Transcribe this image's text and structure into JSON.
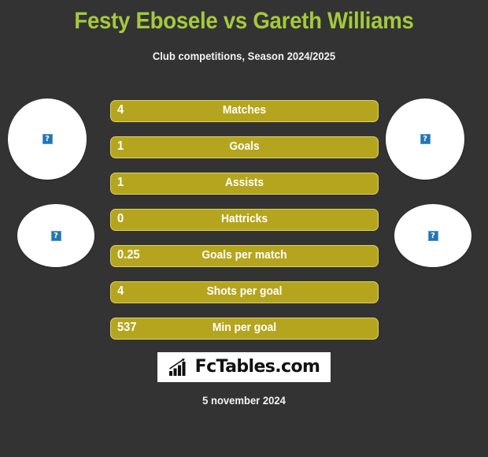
{
  "header": {
    "title": "Festy Ebosele vs Gareth Williams",
    "subtitle": "Club competitions, Season 2024/2025",
    "title_color": "#a5c93c",
    "background_color": "#333333"
  },
  "players": {
    "left": {
      "photo_alt": "broken-image",
      "placeholder_glyph": "?"
    },
    "right": {
      "photo_alt": "broken-image",
      "placeholder_glyph": "?"
    }
  },
  "chart_data": {
    "type": "bar",
    "title": "Festy Ebosele vs Gareth Williams",
    "subtitle": "Club competitions, Season 2024/2025",
    "categories": [
      "Matches",
      "Goals",
      "Assists",
      "Hattricks",
      "Goals per match",
      "Shots per goal",
      "Min per goal"
    ],
    "series": [
      {
        "name": "Festy Ebosele",
        "values": [
          4,
          1,
          1,
          0,
          0.25,
          4,
          537
        ],
        "labels": [
          "4",
          "1",
          "1",
          "0",
          "0.25",
          "4",
          "537"
        ]
      }
    ],
    "bar_fill_color": "#b5a51e",
    "bar_border_color": "#d8d35e",
    "label_color": "#ffffff",
    "grid": false,
    "legend": "none"
  },
  "rows": [
    {
      "value": "4",
      "label": "Matches"
    },
    {
      "value": "1",
      "label": "Goals"
    },
    {
      "value": "1",
      "label": "Assists"
    },
    {
      "value": "0",
      "label": "Hattricks"
    },
    {
      "value": "0.25",
      "label": "Goals per match"
    },
    {
      "value": "4",
      "label": "Shots per goal"
    },
    {
      "value": "537",
      "label": "Min per goal"
    }
  ],
  "footer": {
    "logo_text": "FcTables.com",
    "logo_icon": "bar-chart-trend-icon",
    "date": "5 november 2024"
  }
}
